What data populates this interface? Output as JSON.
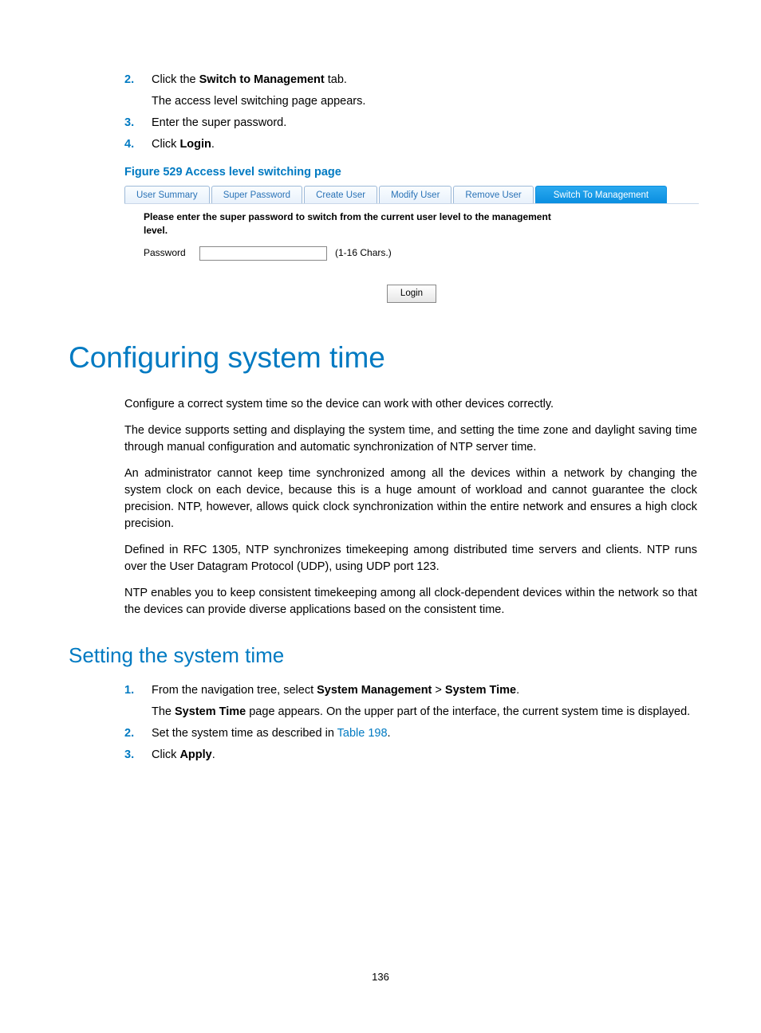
{
  "steps_top": {
    "s2_num": "2.",
    "s2_a": "Click the ",
    "s2_b": "Switch to Management",
    "s2_c": " tab.",
    "s2_sub": "The access level switching page appears.",
    "s3_num": "3.",
    "s3": "Enter the super password.",
    "s4_num": "4.",
    "s4_a": "Click ",
    "s4_b": "Login",
    "s4_c": "."
  },
  "figure": {
    "caption": "Figure 529 Access level switching page",
    "tabs": {
      "user_summary": "User Summary",
      "super_password": "Super Password",
      "create_user": "Create User",
      "modify_user": "Modify User",
      "remove_user": "Remove User",
      "switch_mgmt": "Switch To Management"
    },
    "msg": "Please enter the super password to switch from the current user level to the management level.",
    "password_label": "Password",
    "password_hint": "(1-16 Chars.)",
    "login_label": "Login"
  },
  "heading1": "Configuring system time",
  "para1": "Configure a correct system time so the device can work with other devices correctly.",
  "para2": "The device supports setting and displaying the system time, and setting the time zone and daylight saving time through manual configuration and automatic synchronization of NTP server time.",
  "para3": "An administrator cannot keep time synchronized among all the devices within a network by changing the system clock on each device, because this is a huge amount of workload and cannot guarantee the clock precision. NTP, however, allows quick clock synchronization within the entire network and ensures a high clock precision.",
  "para4": "Defined in RFC 1305, NTP synchronizes timekeeping among distributed time servers and clients. NTP runs over the User Datagram Protocol (UDP), using UDP port 123.",
  "para5": "NTP enables you to keep consistent timekeeping among all clock-dependent devices within the network so that the devices can provide diverse applications based on the consistent time.",
  "heading2": "Setting the system time",
  "steps_bottom": {
    "s1_num": "1.",
    "s1_a": "From the navigation tree, select ",
    "s1_b": "System Management",
    "s1_c": " > ",
    "s1_d": "System Time",
    "s1_e": ".",
    "s1_sub_a": "The ",
    "s1_sub_b": "System Time",
    "s1_sub_c": " page appears. On the upper part of the interface, the current system time is displayed.",
    "s2_num": "2.",
    "s2_a": "Set the system time as described in ",
    "s2_link": "Table 198",
    "s2_c": ".",
    "s3_num": "3.",
    "s3_a": "Click ",
    "s3_b": "Apply",
    "s3_c": "."
  },
  "page_number": "136"
}
